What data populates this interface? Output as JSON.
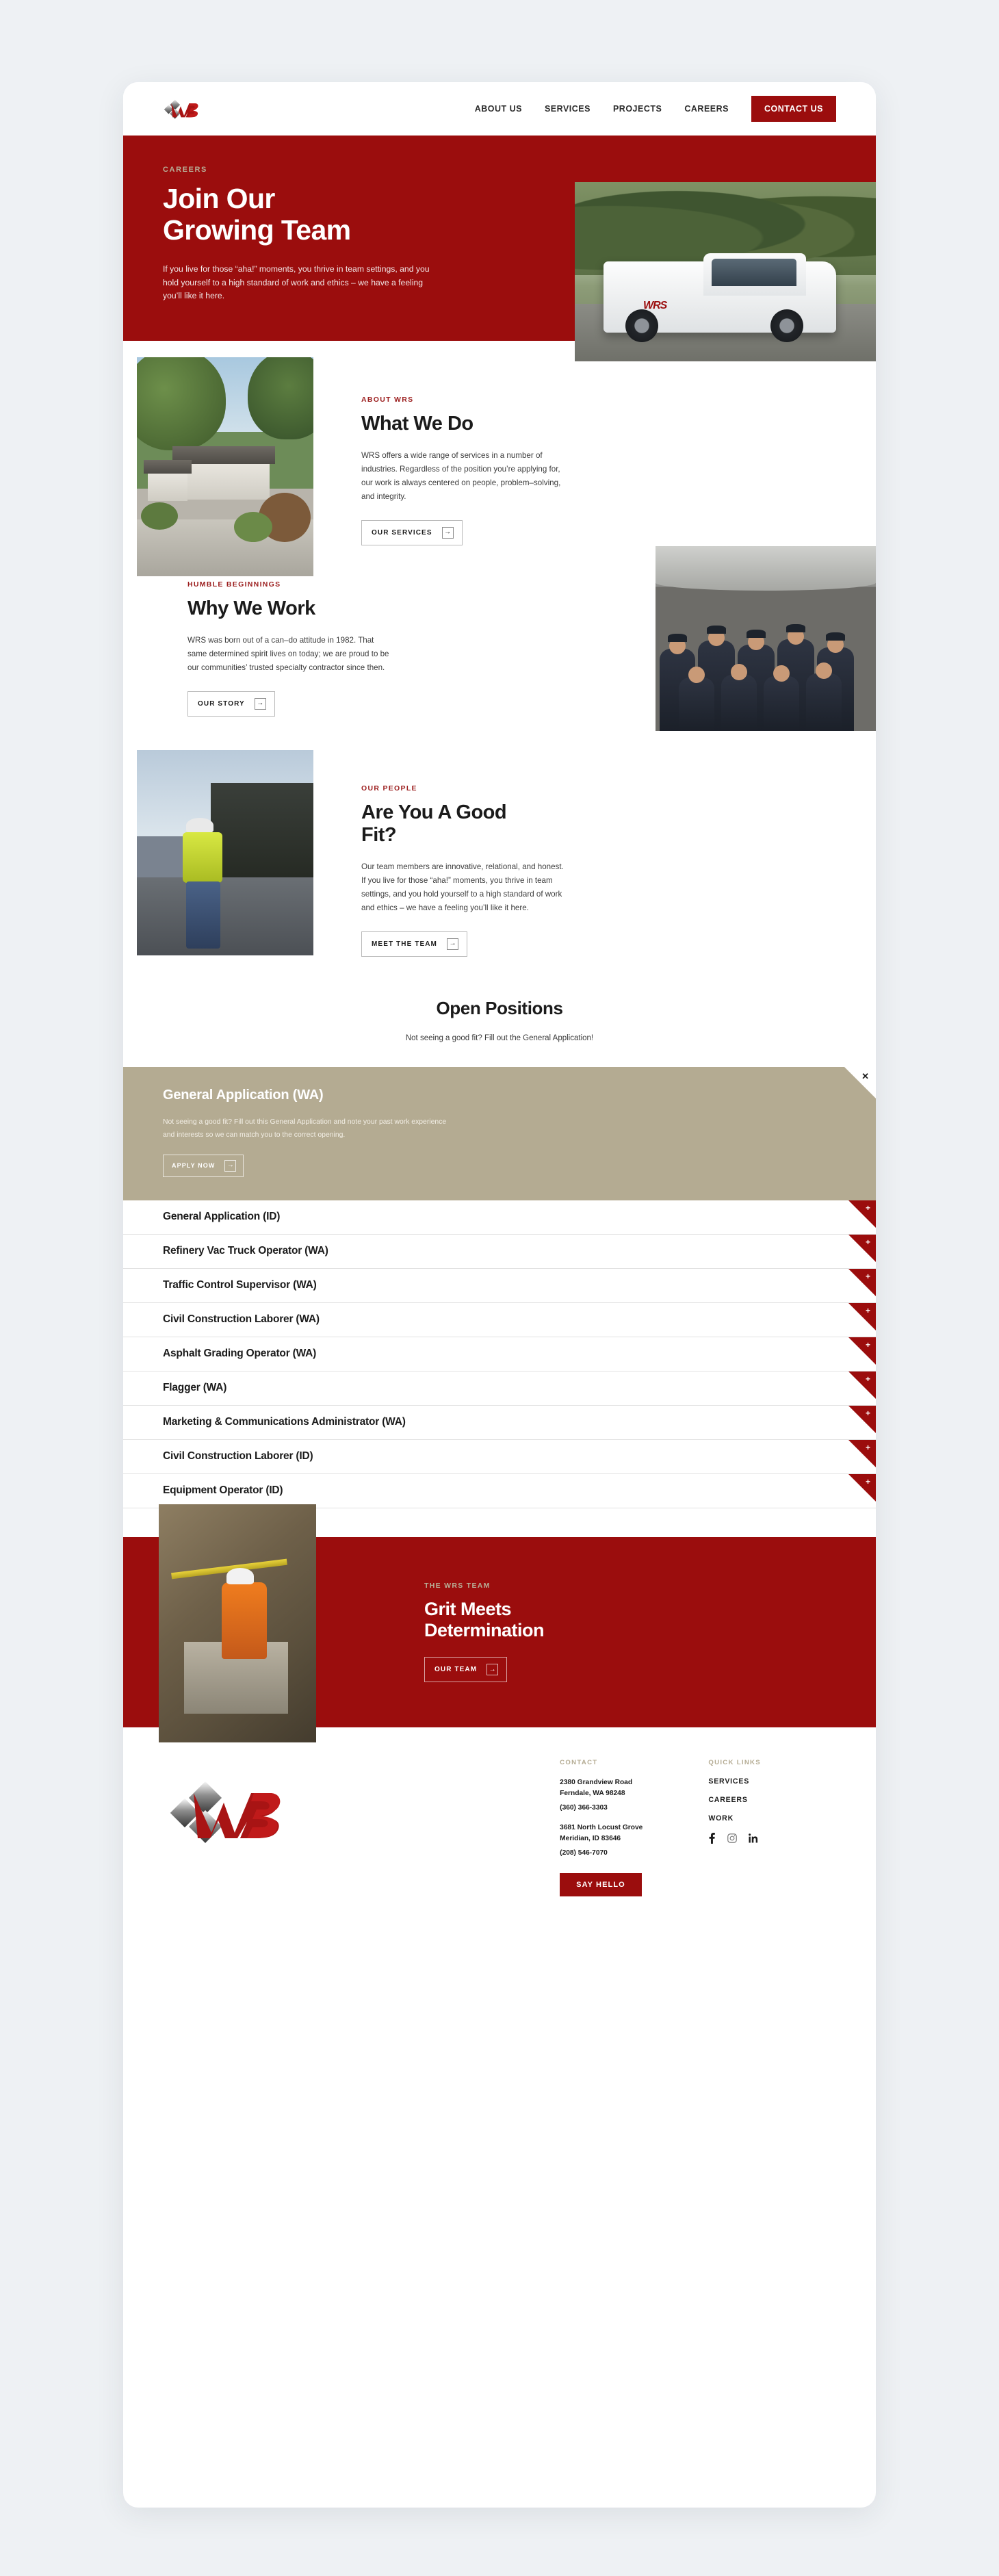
{
  "header": {
    "logo_alt": "WRS",
    "nav": [
      {
        "label": "ABOUT US"
      },
      {
        "label": "SERVICES"
      },
      {
        "label": "PROJECTS"
      },
      {
        "label": "CAREERS"
      }
    ],
    "contact_button": "CONTACT US"
  },
  "hero": {
    "eyebrow": "CAREERS",
    "title_line1": "Join Our",
    "title_line2": "Growing Team",
    "body": "If you live for those “aha!” moments, you thrive in team settings, and you hold yourself to a high standard of work and ethics – we have a feeling you’ll like it here."
  },
  "what_we_do": {
    "kicker": "ABOUT WRS",
    "title": "What We Do",
    "body": "WRS offers a wide range of services in a number of industries. Regardless of the position you’re applying for, our work is always centered on people, problem–solving, and integrity.",
    "button": "OUR SERVICES"
  },
  "why_we_work": {
    "kicker": "HUMBLE BEGINNINGS",
    "title": "Why We Work",
    "body": "WRS was born out of a can–do attitude in 1982. That same determined spirit lives on today; we are proud to be our communities’ trusted specialty contractor since then.",
    "button": "OUR STORY"
  },
  "good_fit": {
    "kicker": "OUR PEOPLE",
    "title_line1": "Are You A Good",
    "title_line2": "Fit?",
    "body": "Our team members are innovative, relational, and honest. If you live for those “aha!” moments, you thrive in team settings, and you hold yourself to a high standard of work and ethics – we have a feeling you’ll like it here.",
    "button": "MEET THE TEAM"
  },
  "open_positions": {
    "title": "Open Positions",
    "subtitle": "Not seeing a good fit? Fill out the General Application!",
    "expanded": {
      "title": "General Application (WA)",
      "body": "Not seeing a good fit? Fill out this General Application and note your past work experience and interests so we can match you to the correct opening.",
      "button": "APPLY NOW",
      "close_label": "✕"
    },
    "expand_glyph": "+",
    "rows": [
      {
        "title": "General Application (ID)"
      },
      {
        "title": "Refinery Vac Truck Operator (WA)"
      },
      {
        "title": "Traffic Control Supervisor (WA)"
      },
      {
        "title": "Civil Construction Laborer (WA)"
      },
      {
        "title": "Asphalt Grading Operator (WA)"
      },
      {
        "title": "Flagger (WA)"
      },
      {
        "title": "Marketing & Communications Administrator (WA)"
      },
      {
        "title": "Civil Construction Laborer (ID)"
      },
      {
        "title": "Equipment Operator (ID)"
      }
    ]
  },
  "grit": {
    "kicker": "THE WRS TEAM",
    "title_line1": "Grit Meets",
    "title_line2": "Determination",
    "button": "OUR TEAM"
  },
  "footer": {
    "contact_heading": "CONTACT",
    "address1_line1": "2380 Grandview Road",
    "address1_line2": "Ferndale, WA 98248",
    "phone1": "(360) 366-3303",
    "address2_line1": "3681 North Locust Grove",
    "address2_line2": "Meridian, ID 83646",
    "phone2": "(208) 546-7070",
    "say_hello": "SAY HELLO",
    "quick_links_heading": "QUICK LINKS",
    "links": [
      {
        "label": "SERVICES"
      },
      {
        "label": "CAREERS"
      },
      {
        "label": "WORK"
      }
    ],
    "socials": [
      {
        "name": "facebook"
      },
      {
        "name": "instagram"
      },
      {
        "name": "linkedin"
      }
    ]
  },
  "colors": {
    "brand_red": "#9b0d0d",
    "tan": "#b4ab92",
    "ink": "#1b1b1b",
    "page_bg": "#eef1f4"
  }
}
